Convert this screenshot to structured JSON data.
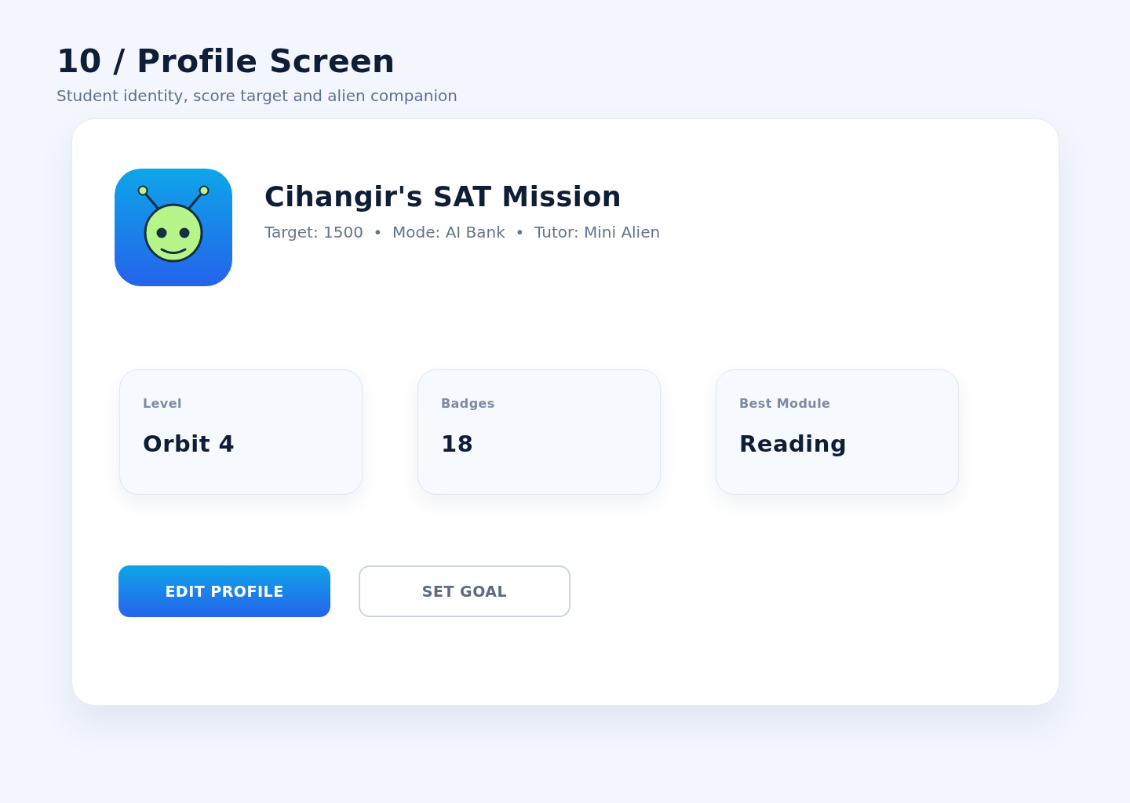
{
  "page": {
    "title": "10 / Profile Screen",
    "subtitle": "Student identity, score target and alien companion"
  },
  "profile": {
    "name": "Cihangir's SAT Mission",
    "meta": "Target: 1500  •  Mode: AI Bank  •  Tutor: Mini Alien"
  },
  "stats": [
    {
      "label": "Level",
      "value": "Orbit 4"
    },
    {
      "label": "Badges",
      "value": "18"
    },
    {
      "label": "Best Module",
      "value": "Reading"
    }
  ],
  "buttons": [
    {
      "label": "EDIT PROFILE",
      "kind": "primary"
    },
    {
      "label": "SET GOAL",
      "kind": "secondary"
    }
  ]
}
